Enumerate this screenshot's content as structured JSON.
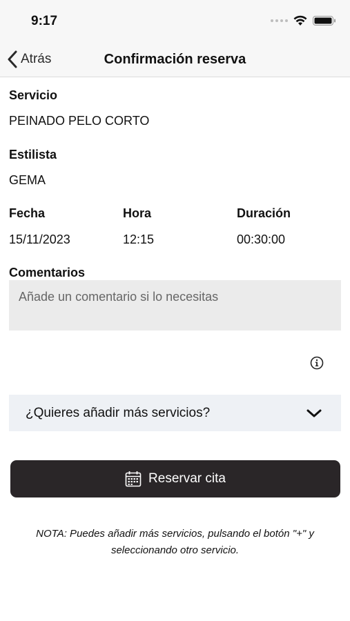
{
  "status_bar": {
    "time": "9:17"
  },
  "nav": {
    "back_label": "Atrás",
    "title": "Confirmación reserva"
  },
  "booking": {
    "service_label": "Servicio",
    "service_value": "PEINADO PELO CORTO",
    "stylist_label": "Estilista",
    "stylist_value": "GEMA",
    "date_label": "Fecha",
    "date_value": "15/11/2023",
    "time_label": "Hora",
    "time_value": "12:15",
    "duration_label": "Duración",
    "duration_value": "00:30:00",
    "comments_label": "Comentarios",
    "comments_placeholder": "Añade un comentario si lo necesitas",
    "comments_value": ""
  },
  "more_services": {
    "label": "¿Quieres añadir más servicios?"
  },
  "reserve_button": {
    "label": "Reservar cita"
  },
  "note": "NOTA: Puedes añadir más servicios, pulsando el botón \"+\" y seleccionando otro servicio.",
  "colors": {
    "button_bg": "#2a2628",
    "comment_bg": "#ebebeb",
    "accordion_bg": "#eef1f5",
    "nav_bg": "#f7f7f7"
  },
  "icons": [
    "signal-icon",
    "wifi-icon",
    "battery-icon",
    "chevron-left-icon",
    "info-icon",
    "chevron-down-icon",
    "calendar-icon"
  ]
}
